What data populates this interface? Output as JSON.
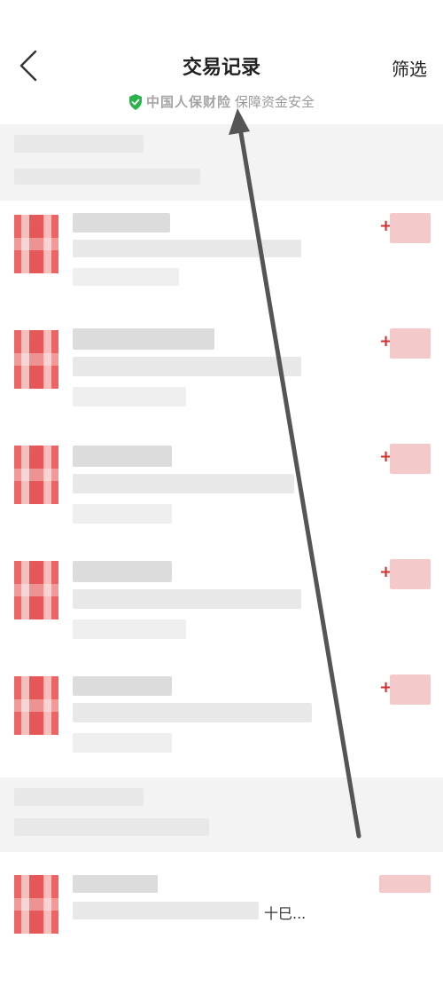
{
  "header": {
    "title": "交易记录",
    "filter_label": "筛选",
    "insurance_brand": "中国人保财险",
    "insurance_text": "保障资金安全"
  },
  "rows": [
    {
      "sign": "+"
    },
    {
      "sign": "+"
    },
    {
      "sign": "+"
    },
    {
      "sign": "+"
    },
    {
      "sign": "+"
    }
  ],
  "last_row": {
    "trailing_text": "十巳..."
  },
  "colors": {
    "accent_red": "#d32f2f",
    "shield_green": "#2bb24c"
  },
  "icons": {
    "back": "chevron-left-icon",
    "shield": "shield-check-icon"
  }
}
